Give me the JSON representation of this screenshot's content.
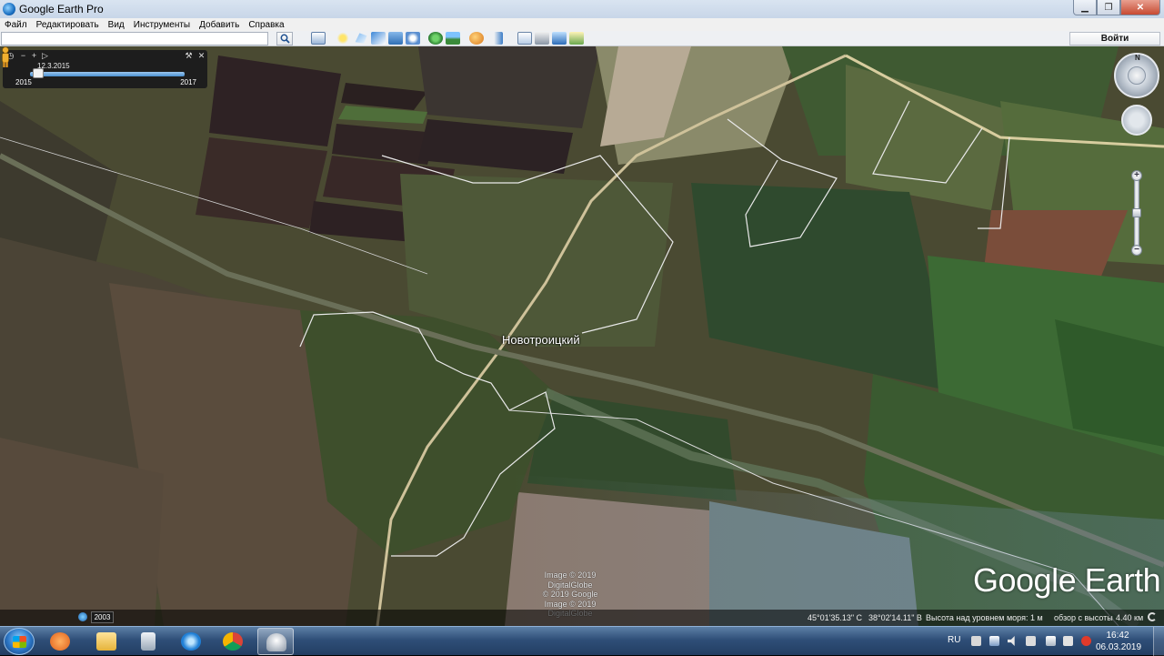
{
  "window": {
    "title": "Google Earth Pro",
    "minimize_icon": "minimize-icon",
    "maximize_icon": "restore-icon",
    "close_icon": "close-icon"
  },
  "menu": {
    "items": [
      "Файл",
      "Редактировать",
      "Вид",
      "Инструменты",
      "Добавить",
      "Справка"
    ]
  },
  "toolbar": {
    "search_value": "",
    "login_label": "Войти",
    "icons": [
      "search-icon",
      "sidebar-icon",
      "placemark-icon",
      "polygon-icon",
      "path-icon",
      "image-overlay-icon",
      "record-tour-icon",
      "historical-imagery-icon",
      "sun-icon",
      "planets-icon",
      "ruler-icon",
      "email-icon",
      "print-icon",
      "save-image-icon",
      "view-in-maps-icon"
    ]
  },
  "time_slider": {
    "current_date": "12.3.2015",
    "start_year": "2015",
    "end_year": "2017",
    "position_fraction": 0.05
  },
  "map": {
    "place_label": "Новотроицкий",
    "credits": [
      "Image © 2019 DigitalGlobe",
      "© 2019 Google",
      "Image © 2019 DigitalGlobe"
    ],
    "logo": "Google Earth",
    "compass_label": "N"
  },
  "status": {
    "history_year": "2003",
    "latitude": "45°01'35.13\" С",
    "longitude": "38°02'14.11\" В",
    "elevation_label": "Высота над уровнем моря:",
    "elevation_value": "1 м",
    "eye_alt_label": "обзор с высоты",
    "eye_alt_value": "4.40 км"
  },
  "taskbar": {
    "apps": [
      "start-menu",
      "media-player",
      "file-explorer",
      "calculator",
      "internet-explorer",
      "chrome",
      "google-earth-pro"
    ],
    "active_app": "google-earth-pro",
    "language": "RU",
    "time": "16:42",
    "date": "06.03.2019"
  }
}
